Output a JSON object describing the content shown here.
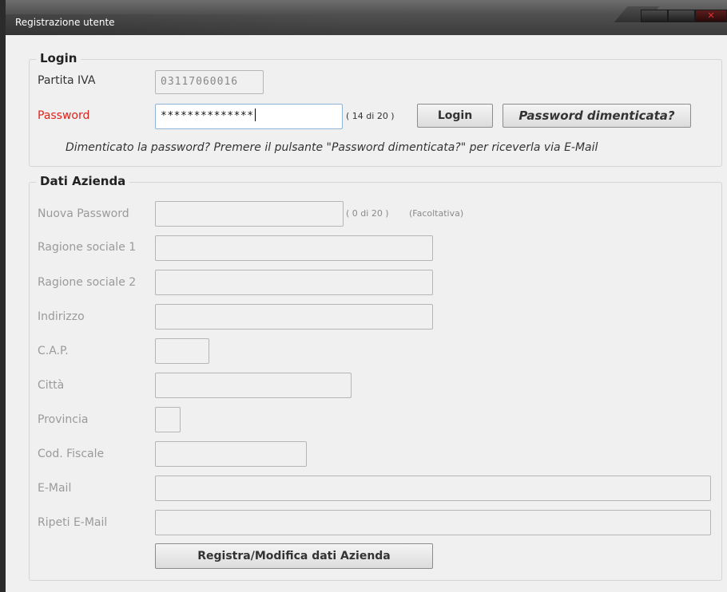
{
  "window": {
    "title": "Registrazione utente"
  },
  "login": {
    "legend": "Login",
    "partita_iva_label": "Partita IVA",
    "partita_iva_value": "03117060016",
    "password_label": "Password",
    "password_value": "**************",
    "password_counter": "( 14 di 20 )",
    "login_button": "Login",
    "forgot_button": "Password dimenticata?",
    "hint": "Dimenticato la password? Premere il pulsante \"Password dimenticata?\" per riceverla via E-Mail"
  },
  "azienda": {
    "legend": "Dati Azienda",
    "nuova_password_label": "Nuova Password",
    "nuova_password_counter": "( 0 di 20 )",
    "nuova_password_note": "(Facoltativa)",
    "ragione1_label": "Ragione sociale 1",
    "ragione2_label": "Ragione sociale 2",
    "indirizzo_label": "Indirizzo",
    "cap_label": "C.A.P.",
    "citta_label": "Città",
    "provincia_label": "Provincia",
    "cod_fiscale_label": "Cod. Fiscale",
    "email_label": "E-Mail",
    "ripeti_email_label": "Ripeti E-Mail",
    "submit_button": "Registra/Modifica dati Azienda"
  },
  "colors": {
    "required_label": "#e0211b",
    "disabled_label": "#9a9a9a",
    "focus_border": "#8fb4d8"
  },
  "icons": {
    "close": "close-icon",
    "minimize": "minimize-icon",
    "maximize": "maximize-icon"
  }
}
